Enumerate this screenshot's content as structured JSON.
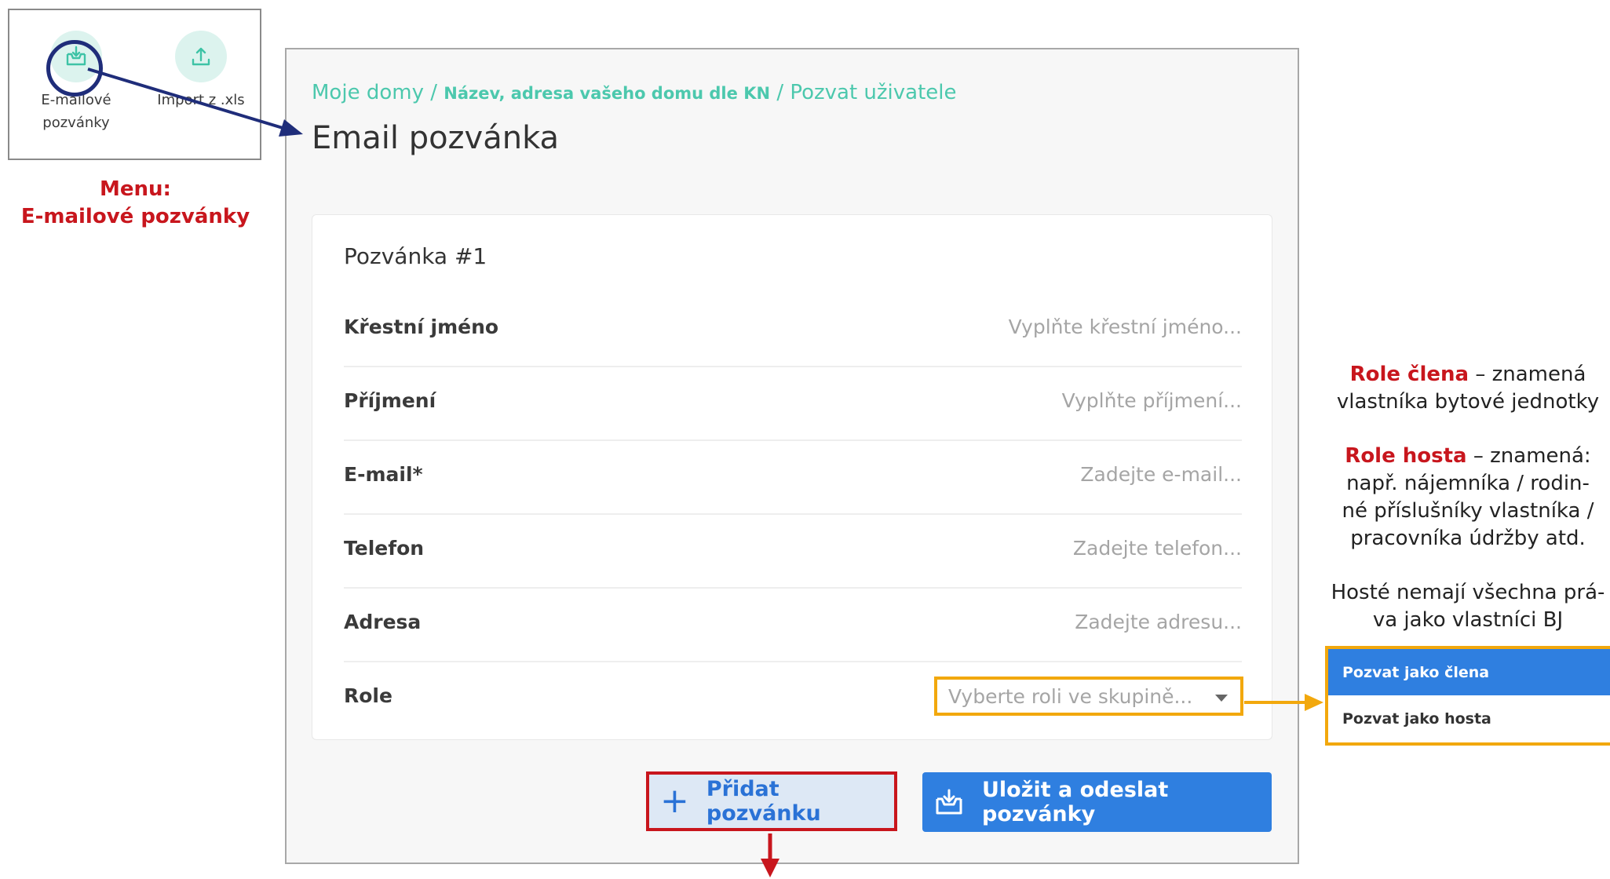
{
  "menu": {
    "items": [
      {
        "label": "E-mailové pozvánky",
        "icon": "inbox-download-icon"
      },
      {
        "label": "Import z .xls",
        "icon": "upload-icon"
      }
    ],
    "caption_line1": "Menu:",
    "caption_line2": "E-mailové pozvánky"
  },
  "breadcrumb": {
    "part1": "Moje domy /",
    "part2": "Název, adresa vašeho domu dle KN",
    "part3": "/ Pozvat uživatele"
  },
  "page_title": "Email pozvánka",
  "invitation": {
    "title": "Pozvánka #1",
    "fields": [
      {
        "label": "Křestní jméno",
        "placeholder": "Vyplňte křestní jméno..."
      },
      {
        "label": "Příjmení",
        "placeholder": "Vyplňte příjmení..."
      },
      {
        "label": "E-mail*",
        "placeholder": "Zadejte e-mail..."
      },
      {
        "label": "Telefon",
        "placeholder": "Zadejte telefon..."
      },
      {
        "label": "Adresa",
        "placeholder": "Zadejte adresu..."
      }
    ],
    "role": {
      "label": "Role",
      "placeholder": "Vyberte roli ve skupině..."
    }
  },
  "buttons": {
    "add_label": "Přidat pozvánku",
    "save_label": "Uložit a odeslat pozvánky"
  },
  "notes": {
    "member_title": "Role člena",
    "member_text1": " – znamená",
    "member_text2": "vlastníka bytové jednotky",
    "guest_title": "Role hosta",
    "guest_text1": " – znamená:",
    "guest_text2": "např. nájemníka / rodin-",
    "guest_text3": "né příslušníky vlastníka /",
    "guest_text4": "pracovníka údržby atd.",
    "rights_line1": "Hosté nemají všechna prá-",
    "rights_line2": "va jako vlastníci BJ"
  },
  "role_options": [
    "Pozvat jako člena",
    "Pozvat jako hosta"
  ],
  "colors": {
    "accent_teal": "#4cc8ad",
    "primary_blue": "#2f7fe0",
    "highlight_red": "#c8161d",
    "highlight_orange": "#f2a80d",
    "arrow_navy": "#1f2d7a"
  }
}
